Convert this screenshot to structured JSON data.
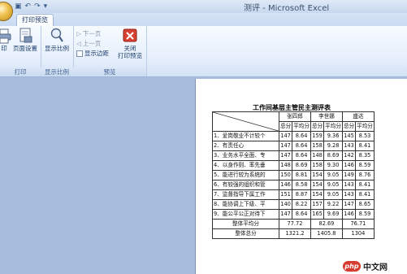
{
  "window": {
    "title": "测评 - Microsoft Excel"
  },
  "ribbon": {
    "active_tab": "打印预览",
    "groups": [
      {
        "label": "打印",
        "buttons": [
          "打印",
          "页面设置"
        ]
      },
      {
        "label": "显示比例",
        "buttons": [
          "显示比例"
        ]
      },
      {
        "label": "预览",
        "buttons": [
          "下一页",
          "上一页",
          "显示边距",
          "关闭打印预览"
        ]
      }
    ],
    "print": "印",
    "page_setup": "页面设置",
    "zoom": "显示比例",
    "next_page": "下一页",
    "prev_page": "上一页",
    "show_margins": "显示边距",
    "close_preview_line1": "关闭",
    "close_preview_line2": "打印预览",
    "group_print": "打印",
    "group_zoom": "显示比例",
    "group_preview": "预览"
  },
  "sheet": {
    "title": "工作间基层主管民主测评表",
    "people": [
      "张四郎",
      "李世娜",
      "盛达"
    ],
    "subheaders": [
      "总分",
      "平均分",
      "总分",
      "平均分",
      "总分",
      "平均分"
    ],
    "rows": [
      {
        "item": "1、爱岗敬业不计较个",
        "vals": [
          "147",
          "8.64",
          "159",
          "9.36",
          "145",
          "8.53"
        ]
      },
      {
        "item": "2、有责任心",
        "vals": [
          "147",
          "8.64",
          "158",
          "9.28",
          "143",
          "8.41"
        ]
      },
      {
        "item": "3、业务水平全面、专",
        "vals": [
          "147",
          "8.64",
          "148",
          "8.69",
          "142",
          "8.35"
        ]
      },
      {
        "item": "4、以身作则、率先垂",
        "vals": [
          "148",
          "8.69",
          "158",
          "9.30",
          "146",
          "8.59"
        ]
      },
      {
        "item": "5、能进行较为系统的",
        "vals": [
          "150",
          "8.81",
          "154",
          "9.05",
          "149",
          "8.76"
        ]
      },
      {
        "item": "6、有较强的组织和管",
        "vals": [
          "146",
          "8.58",
          "154",
          "9.05",
          "143",
          "8.41"
        ]
      },
      {
        "item": "7、监督指导下属工作",
        "vals": [
          "151",
          "8.87",
          "154",
          "9.05",
          "143",
          "8.41"
        ]
      },
      {
        "item": "8、能协调上下级、平",
        "vals": [
          "140",
          "8.22",
          "157",
          "9.22",
          "147",
          "8.65"
        ]
      },
      {
        "item": "9、能公平公正对待下",
        "vals": [
          "147",
          "8.64",
          "165",
          "9.69",
          "146",
          "8.59"
        ]
      }
    ],
    "avg_label": "整体平均分",
    "avg_vals": [
      "77.72",
      "82.69",
      "76.71"
    ],
    "total_label": "整体总分",
    "total_vals": [
      "1321.2",
      "1405.8",
      "1304"
    ]
  },
  "watermark": {
    "logo": "php",
    "text": "中文网"
  },
  "colors": {
    "ribbon_top": "#f7fbff",
    "workspace": "#a8bddc",
    "accent_red": "#d63b2f"
  },
  "icons": [
    "office-button-icon",
    "save-icon",
    "undo-icon",
    "redo-icon",
    "print-icon",
    "page-setup-icon",
    "zoom-icon",
    "close-preview-icon"
  ]
}
